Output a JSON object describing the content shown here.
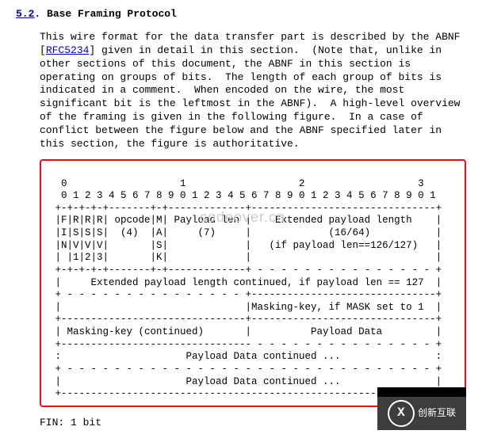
{
  "heading": {
    "section_number": "5.2",
    "sep": ".  ",
    "title": "Base Framing Protocol"
  },
  "paragraph": {
    "line1": "This wire format for the data transfer part is described by the ABNF",
    "line2a": "[",
    "rfc_link": "RFC5234",
    "line2b": "] given in detail in this section.  (Note that, unlike in",
    "line3": "other sections of this document, the ABNF in this section is",
    "line4": "operating on groups of bits.  The length of each group of bits is",
    "line5": "indicated in a comment.  When encoded on the wire, the most",
    "line6": "significant bit is the leftmost in the ABNF).  A high-level overview",
    "line7": "of the framing is given in the following figure.  In a case of",
    "line8": "conflict between the figure below and the ABNF specified later in",
    "line9": "this section, the figure is authoritative."
  },
  "diagram": {
    "r01": "  0                   1                   2                   3",
    "r02": "  0 1 2 3 4 5 6 7 8 9 0 1 2 3 4 5 6 7 8 9 0 1 2 3 4 5 6 7 8 9 0 1",
    "r03": " +-+-+-+-+-------+-+-------------+-------------------------------+",
    "r04": " |F|R|R|R| opcode|M| Payload len |    Extended payload length    |",
    "r05": " |I|S|S|S|  (4)  |A|     (7)     |             (16/64)           |",
    "r06": " |N|V|V|V|       |S|             |   (if payload len==126/127)   |",
    "r07": " | |1|2|3|       |K|             |                               |",
    "r08": " +-+-+-+-+-------+-+-------------+ - - - - - - - - - - - - - - - +",
    "r09": " |     Extended payload length continued, if payload len == 127  |",
    "r10": " + - - - - - - - - - - - - - - - +-------------------------------+",
    "r11": " |                               |Masking-key, if MASK set to 1  |",
    "r12": " +-------------------------------+-------------------------------+",
    "r13": " | Masking-key (continued)       |          Payload Data         |",
    "r14": " +-------------------------------- - - - - - - - - - - - - - - - +",
    "r15": " :                     Payload Data continued ...                :",
    "r16": " + - - - - - - - - - - - - - - - - - - - - - - - - - - - - - - - +",
    "r17": " |                     Payload Data continued ...                |",
    "r18": " +---------------------------------------------------------------+"
  },
  "watermark": "codeover.cn",
  "field": {
    "name": "FIN:",
    "bits": "  1 bit"
  },
  "footer": {
    "logo_letter": "X",
    "brand": "创新互联"
  }
}
